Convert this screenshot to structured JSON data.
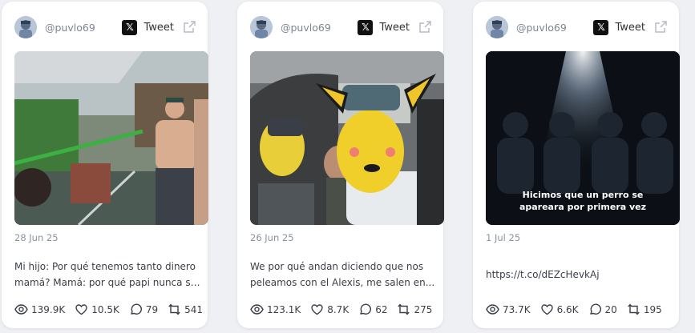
{
  "colors": {
    "page_bg": "#eef0f3",
    "card_bg": "#ffffff",
    "muted": "#8b93a1",
    "text": "#3a3f48"
  },
  "cards": [
    {
      "handle": "@puvlo69",
      "tweet_label": "Tweet",
      "date": "28 Jun 25",
      "text_lines": [
        "Mi hijo: Por qué tenemos tanto dinero",
        "mamá? Mamá: por qué papi nunca se..."
      ],
      "views": "139.9K",
      "likes": "10.5K",
      "replies": "79",
      "retweets": "541"
    },
    {
      "handle": "@puvlo69",
      "tweet_label": "Tweet",
      "date": "26 Jun 25",
      "text_lines": [
        "We por qué andan diciendo que nos",
        "peleamos con el Alexis, me salen en..."
      ],
      "views": "123.1K",
      "likes": "8.7K",
      "replies": "62",
      "retweets": "275"
    },
    {
      "handle": "@puvlo69",
      "tweet_label": "Tweet",
      "date": "1 Jul 25",
      "text_lines": [
        "https://t.co/dEZcHevkAj"
      ],
      "media_caption": [
        "Hicimos que un perro se",
        "apareara por primera vez"
      ],
      "views": "73.7K",
      "likes": "6.6K",
      "replies": "20",
      "retweets": "195"
    }
  ]
}
